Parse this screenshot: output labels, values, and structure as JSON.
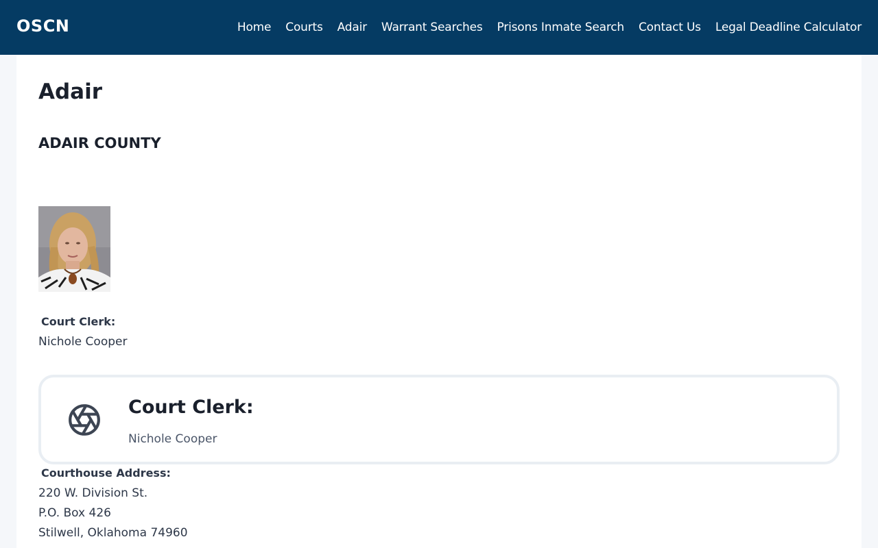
{
  "header": {
    "brand": "OSCN",
    "nav": [
      {
        "label": "Home"
      },
      {
        "label": "Courts"
      },
      {
        "label": "Adair"
      },
      {
        "label": "Warrant Searches"
      },
      {
        "label": "Prisons Inmate Search"
      },
      {
        "label": "Contact Us"
      },
      {
        "label": "Legal Deadline Calculator"
      }
    ],
    "bg_color": "#053b63"
  },
  "main": {
    "title": "Adair",
    "subtitle": "ADAIR COUNTY",
    "court_clerk_label": "Court Clerk:",
    "court_clerk_name": "Nichole Cooper",
    "card": {
      "icon": "aperture-icon",
      "title": "Court Clerk:",
      "name": "Nichole Cooper"
    },
    "address_label": "Courthouse Address:",
    "address_lines": [
      "220 W. Division St.",
      "P.O. Box 426",
      "Stilwell, Oklahoma 74960"
    ]
  }
}
